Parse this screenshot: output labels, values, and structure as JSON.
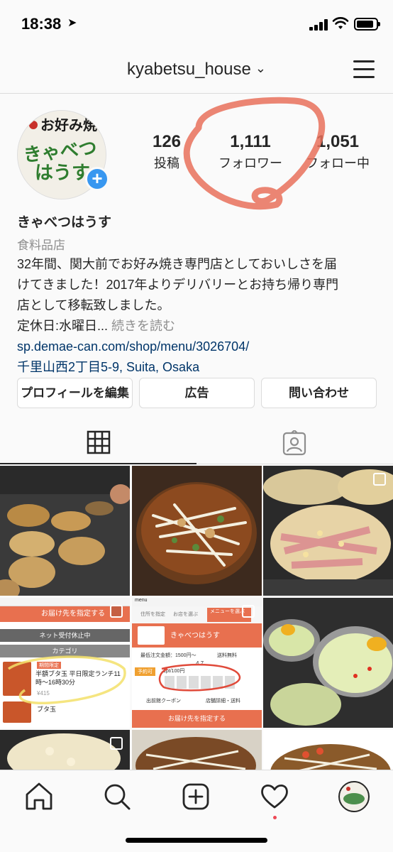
{
  "status": {
    "time": "18:38",
    "battery_level": 0.9
  },
  "header": {
    "username": "kyabetsu_house",
    "chevron": "chevron-down-icon",
    "menu": "hamburger-menu-icon"
  },
  "profile": {
    "avatar_text_top": "お好み焼",
    "avatar_text_mid": "きゃべつ",
    "avatar_text_bot": "はうす",
    "stats": [
      {
        "num": "126",
        "label": "投稿"
      },
      {
        "num": "1,111",
        "label": "フォロワー"
      },
      {
        "num": "1,051",
        "label": "フォロー中"
      }
    ]
  },
  "bio": {
    "name": "きゃべつはうす",
    "category": "食料品店",
    "line1": "32年間、関大前でお好み焼き専門店としておいしさを届",
    "line2": "けてきました！2017年よりデリバリーとお持ち帰り専門",
    "line3": "店として移転致しました。",
    "line4": "定休日:水曜日... ",
    "more": "続きを読む",
    "link": "sp.demae-can.com/shop/menu/3026704/",
    "address": "千里山西2丁目5-9, Suita, Osaka"
  },
  "buttons": {
    "edit_profile": "プロフィールを編集",
    "ads": "広告",
    "contact": "問い合わせ"
  },
  "tabs": {
    "grid": "grid-icon",
    "tagged": "tagged-person-icon"
  },
  "posts": {
    "p4_banner": "お届け先を指定する",
    "p4_closed": "ネット受付休止中",
    "p4_category": "カテゴリ",
    "p4_item_tag": "期間限定",
    "p4_item_title": "半額ブタ玉 平日限定ランチ11時〜16時30分",
    "p4_item_price": "¥415",
    "p4_item2": "ブタ玉",
    "p5_menu": "menu",
    "p5_step1": "住所を指定",
    "p5_step2": "お店を選ぶ",
    "p5_step3": "メニューを選ぶ",
    "p5_shop": "きゃべつはうす",
    "p5_min_order": "最低注文金額：1500円〜",
    "p5_fee": "送料無料",
    "p5_reserve": "予約可",
    "p5_rating": "4.7",
    "p5_points": "1pt/100円",
    "p5_coupon": "出前館クーポン",
    "p5_detail": "店舗詳細・送料",
    "p5_banner": "お届け先を指定する"
  },
  "nav": [
    "home-icon",
    "search-icon",
    "new-post-icon",
    "activity-heart-icon",
    "profile-avatar-icon"
  ],
  "colors": {
    "accent": "#3897f0",
    "link": "#003569",
    "annotation": "#e8705a",
    "demae_orange": "#e8704f"
  }
}
